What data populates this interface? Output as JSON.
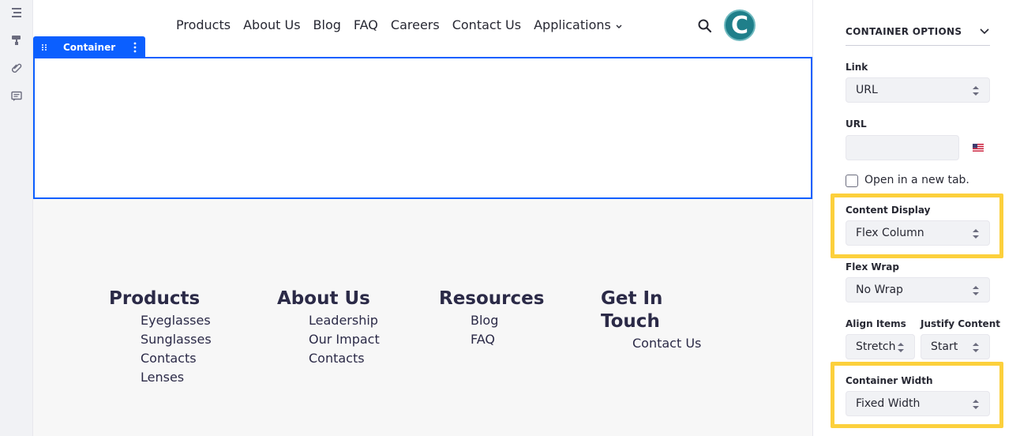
{
  "nav": {
    "links": [
      "Products",
      "About Us",
      "Blog",
      "FAQ",
      "Careers",
      "Contact Us"
    ],
    "dropdown_label": "Applications",
    "avatar_letter": "C"
  },
  "container": {
    "tab_label": "Container"
  },
  "footer": {
    "columns": [
      {
        "title": "Products",
        "items": [
          "Eyeglasses",
          "Sunglasses",
          "Contacts",
          "Lenses"
        ]
      },
      {
        "title": "About Us",
        "items": [
          "Leadership",
          "Our Impact",
          "Contacts"
        ]
      },
      {
        "title": "Resources",
        "items": [
          "Blog",
          "FAQ"
        ]
      },
      {
        "title_line1": "Get In",
        "title_line2": "Touch",
        "items": [
          "Contact Us"
        ]
      }
    ]
  },
  "panel": {
    "title": "CONTAINER OPTIONS",
    "link_label": "Link",
    "link_value": "URL",
    "url_label": "URL",
    "url_value": "",
    "open_new_tab": "Open in a new tab.",
    "content_display_label": "Content Display",
    "content_display_value": "Flex Column",
    "flex_wrap_label": "Flex Wrap",
    "flex_wrap_value": "No Wrap",
    "align_items_label": "Align Items",
    "align_items_value": "Stretch",
    "justify_content_label": "Justify Content",
    "justify_content_value": "Start",
    "container_width_label": "Container Width",
    "container_width_value": "Fixed Width"
  },
  "colors": {
    "accent": "#0b5fff",
    "highlight": "#fcd03c",
    "avatar": "#1f7f8a"
  }
}
